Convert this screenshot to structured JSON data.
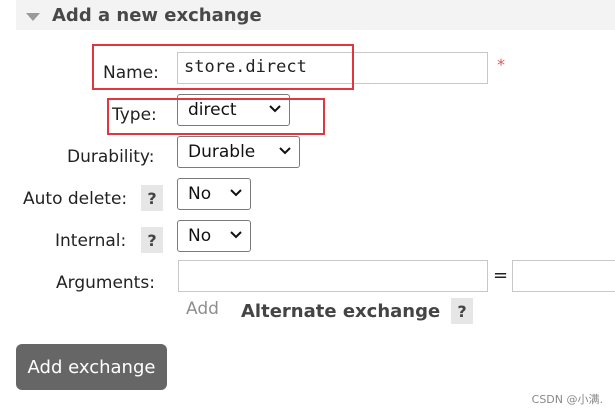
{
  "section": {
    "title": "Add a new exchange"
  },
  "form": {
    "name": {
      "label": "Name:",
      "value": "store.direct",
      "required_mark": "*"
    },
    "type": {
      "label": "Type:",
      "value": "direct"
    },
    "durability": {
      "label": "Durability:",
      "value": "Durable"
    },
    "auto_delete": {
      "label": "Auto delete:",
      "help": "?",
      "value": "No"
    },
    "internal": {
      "label": "Internal:",
      "help": "?",
      "value": "No"
    },
    "arguments": {
      "label": "Arguments:",
      "key_value": "",
      "equals": "=",
      "value_value": ""
    },
    "add_link": "Add",
    "alternate_exchange": {
      "label": "Alternate exchange",
      "help": "?"
    }
  },
  "submit": {
    "label": "Add exchange"
  },
  "watermark": "CSDN @小满."
}
